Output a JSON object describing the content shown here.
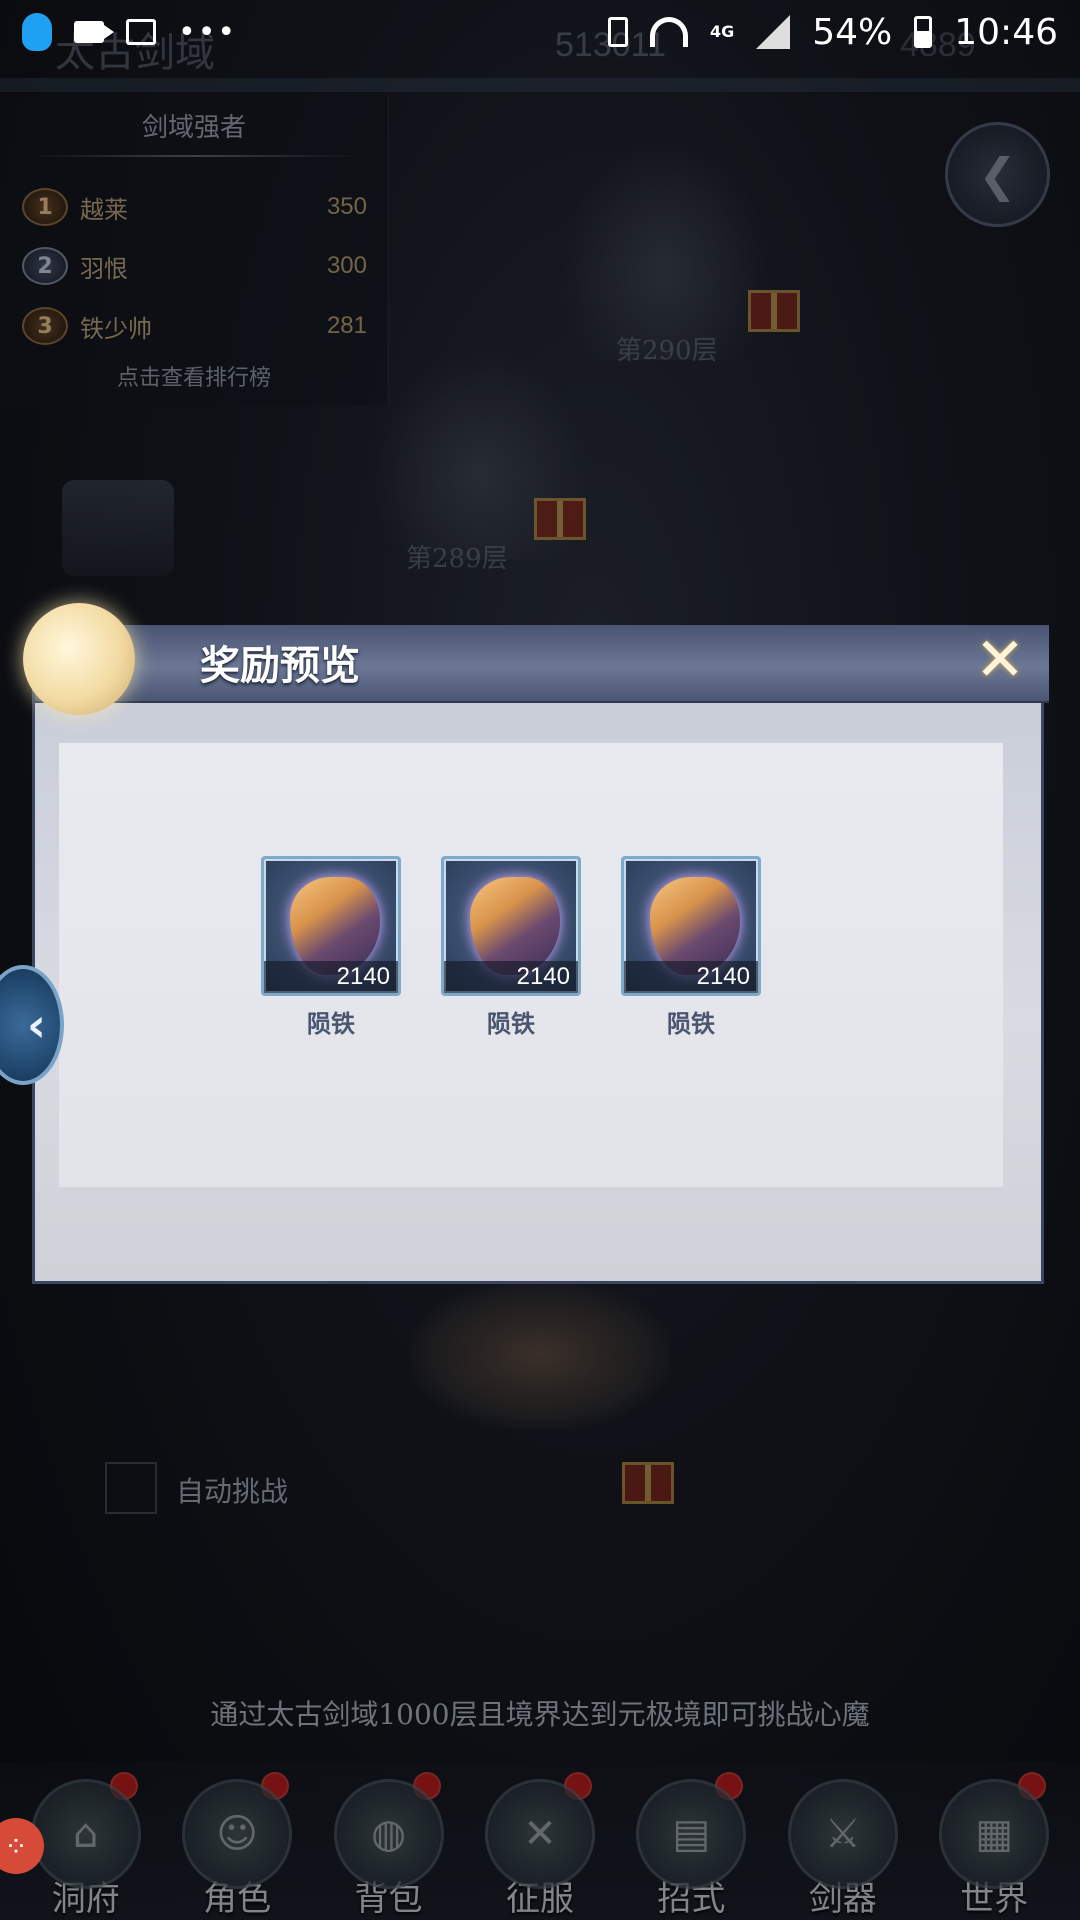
{
  "status_bar": {
    "battery_percent": "54%",
    "time": "10:46",
    "network": "4G",
    "icons": [
      "qq-icon",
      "video-icon",
      "image-icon",
      "more-icon",
      "battery-saver-icon",
      "wifi-icon",
      "signal-icon",
      "battery-icon"
    ]
  },
  "header": {
    "title": "太古剑域",
    "currency_1": "513011",
    "currency_2": "4889"
  },
  "ranking": {
    "title": "剑域强者",
    "rows": [
      {
        "rank": "1",
        "name": "越莱",
        "score": "350"
      },
      {
        "rank": "2",
        "name": "羽恨",
        "score": "300"
      },
      {
        "rank": "3",
        "name": "铁少帅",
        "score": "281"
      }
    ],
    "link_label": "点击查看排行榜"
  },
  "floors": {
    "upper": "第290层",
    "lower": "第289层"
  },
  "modal": {
    "title": "奖励预览",
    "close_icon": "✕",
    "items": [
      {
        "name": "陨铁",
        "count": "2140"
      },
      {
        "name": "陨铁",
        "count": "2140"
      },
      {
        "name": "陨铁",
        "count": "2140"
      }
    ]
  },
  "auto_challenge_label": "自动挑战",
  "hint_text": "通过太古剑域1000层且境界达到元极境即可挑战心魔",
  "nav": [
    {
      "label": "洞府",
      "dot": true
    },
    {
      "label": "角色",
      "dot": true
    },
    {
      "label": "背包",
      "dot": true
    },
    {
      "label": "征服",
      "dot": true
    },
    {
      "label": "招式",
      "dot": true
    },
    {
      "label": "剑器",
      "dot": false
    },
    {
      "label": "世界",
      "dot": true
    }
  ],
  "colors": {
    "modal_header": "#5a6685",
    "item_border": "#7fa9c9",
    "gold_text": "#b7a27a",
    "notification": "#b71c1c"
  }
}
